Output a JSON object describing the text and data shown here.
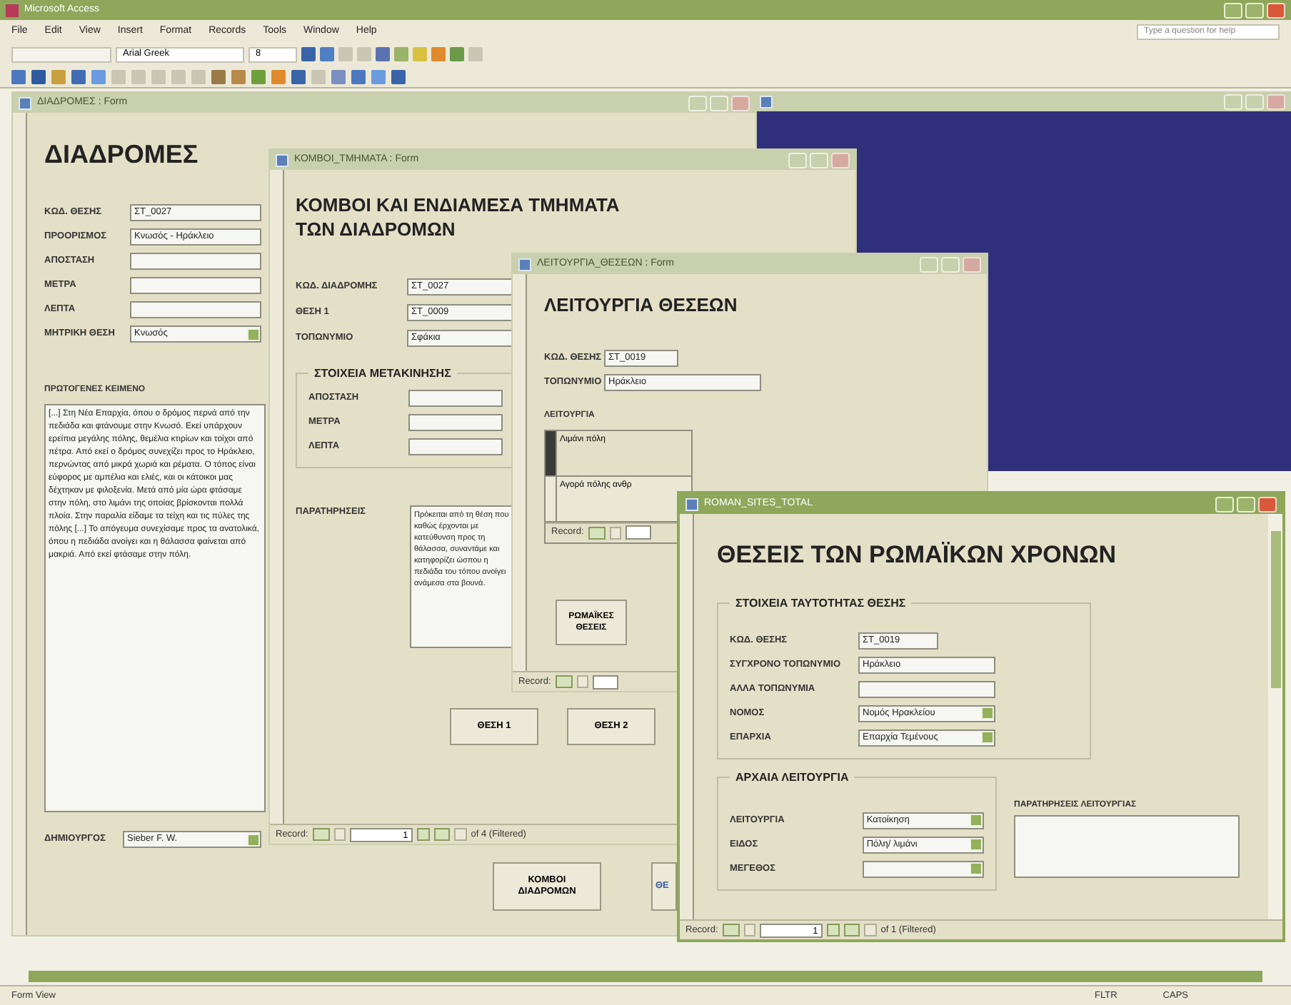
{
  "app": {
    "title": "Microsoft Access",
    "menu": [
      "File",
      "Edit",
      "View",
      "Insert",
      "Format",
      "Records",
      "Tools",
      "Window",
      "Help"
    ],
    "help_box": {
      "placeholder": "Type a question for help"
    },
    "font_box": {
      "value": "Arial Greek"
    },
    "size_box": {
      "value": "8"
    }
  },
  "routes_form": {
    "title": "ΔΙΑΔΡΟΜΕΣ : Form",
    "heading": "ΔΙΑΔΡΟΜΕΣ",
    "fields": [
      {
        "label": "ΚΩΔ. ΘΕΣΗΣ",
        "value": "ΣΤ_0027",
        "kind": "text"
      },
      {
        "label": "ΠΡΟΟΡΙΣΜΟΣ",
        "value": "Κνωσός - Ηράκλειο",
        "kind": "text"
      },
      {
        "label": "ΑΠΟΣΤΑΣΗ",
        "kind": "text"
      },
      {
        "label": "ΜΕΤΡΑ",
        "kind": "text"
      },
      {
        "label": "ΛΕΠΤΑ",
        "kind": "text"
      },
      {
        "label": "ΜΗΤΡΙΚΗ ΘΕΣΗ",
        "value": "Κνωσός",
        "kind": "combo"
      }
    ],
    "memo_label": "ΠΡΩΤΟΓΕΝΕΣ ΚΕΙΜΕΝΟ",
    "memo": "[...] Στη Νέα Επαρχία, όπου ο δρόμος περνά από την πεδιάδα και φτάνουμε στην Κνωσό. Εκεί υπάρχουν ερείπια μεγάλης πόλης, θεμέλια κτιρίων και τοίχοι από πέτρα. Από εκεί ο δρόμος συνεχίζει προς το Ηράκλειο, περνώντας από μικρά χωριά και ρέματα. Ο τόπος είναι εύφορος με αμπέλια και ελιές, και οι κάτοικοι μας δέχτηκαν με φιλοξενία. Μετά από μία ώρα φτάσαμε στην πόλη, στο λιμάνι της οποίας βρίσκονται πολλά πλοία. Στην παραλία είδαμε τα τείχη και τις πύλες της πόλης [...] Το απόγευμα συνεχίσαμε προς τα ανατολικά, όπου η πεδιάδα ανοίγει και η θάλασσα φαίνεται από μακριά. Από εκεί φτάσαμε στην πόλη.",
    "author": {
      "label": "ΔΗΜΙΟΥΡΓΟΣ",
      "value": "Sieber F. W."
    },
    "buttons": [
      "ΚΟΜΒΟΙ ΔΙΑΔΡΟΜΩΝ",
      "ΘΕ"
    ]
  },
  "nodes_form": {
    "title": "ΚΟΜΒΟΙ_ΤΜΗΜΑΤΑ : Form",
    "heading": "ΚΟΜΒΟΙ ΚΑΙ ΕΝΔΙΑΜΕΣΑ ΤΜΗΜΑΤΑ ΤΩΝ ΔΙΑΔΡΟΜΩΝ",
    "fields": [
      {
        "label": "ΚΩΔ. ΔΙΑΔΡΟΜΗΣ",
        "value": "ΣΤ_0027"
      },
      {
        "label": "ΘΕΣΗ 1",
        "value": "ΣΤ_0009"
      },
      {
        "label": "ΤΟΠΩΝΥΜΙΟ",
        "value": "Σφάκια"
      }
    ],
    "group": {
      "title": "ΣΤΟΙΧΕΙΑ ΜΕΤΑΚΙΝΗΣΗΣ",
      "fields": [
        "ΑΠΟΣΤΑΣΗ",
        "ΜΕΤΡΑ",
        "ΛΕΠΤΑ"
      ]
    },
    "notes_label": "ΠΑΡΑΤΗΡΗΣΕΙΣ",
    "notes": "Πρόκειται από τη θέση που καθώς έρχονται με κατεύθυνση προς τη θάλασσα, συναντάμε και κατηφορίζει ώσπου η πεδιάδα του τόπου ανοίγει ανάμεσα στα βουνά.",
    "buttons": [
      "ΘΕΣΗ 1",
      "ΘΕΣΗ 2"
    ],
    "nav": {
      "label": "Record:",
      "current": "1",
      "total": "of 4 (Filtered)"
    }
  },
  "functions_form": {
    "title": "ΛΕΙΤΟΥΡΓΙΑ_ΘΕΣΕΩΝ : Form",
    "heading": "ΛΕΙΤΟΥΡΓΙΑ ΘΕΣΕΩΝ",
    "fields": [
      {
        "label": "ΚΩΔ. ΘΕΣΗΣ",
        "value": "ΣΤ_0019"
      },
      {
        "label": "ΤΟΠΩΝΥΜΙΟ",
        "value": "Ηράκλειο"
      }
    ],
    "subform_label": "ΛΕΙΤΟΥΡΓΙΑ",
    "rows": [
      {
        "value": "Λιμάνι πόλη",
        "selected": true
      },
      {
        "value": "Αγορά πόλης ανθρ",
        "selected": false
      }
    ],
    "sub_nav": {
      "label": "Record:"
    },
    "buttons": [
      "ΡΩΜΑΪΚΕΣ ΘΕΣΕΙΣ"
    ],
    "nav": {
      "label": "Record:"
    }
  },
  "sites_form": {
    "title": "ROMAN_SITES_TOTAL",
    "heading": "ΘΕΣΕΙΣ ΤΩΝ ΡΩΜΑΪΚΩΝ ΧΡΟΝΩΝ",
    "identity": {
      "title": "ΣΤΟΙΧΕΙΑ ΤΑΥΤΟΤΗΤΑΣ ΘΕΣΗΣ",
      "fields": [
        {
          "label": "ΚΩΔ. ΘΕΣΗΣ",
          "value": "ΣΤ_0019",
          "kind": "text"
        },
        {
          "label": "ΣΥΓΧΡΟΝΟ ΤΟΠΩΝΥΜΙΟ",
          "value": "Ηράκλειο",
          "kind": "text"
        },
        {
          "label": "ΑΛΛΑ ΤΟΠΩΝΥΜΙΑ",
          "kind": "text"
        },
        {
          "label": "ΝΟΜΟΣ",
          "value": "Νομός Ηρακλείου",
          "kind": "combo"
        },
        {
          "label": "ΕΠΑΡΧΙΑ",
          "value": "Επαρχία Τεμένους",
          "kind": "combo"
        }
      ]
    },
    "ancient": {
      "title": "ΑΡΧΑΙΑ ΛΕΙΤΟΥΡΓΙΑ",
      "fields": [
        {
          "label": "ΛΕΙΤΟΥΡΓΙΑ",
          "value": "Κατοίκηση"
        },
        {
          "label": "ΕΙΔΟΣ",
          "value": "Πόλη/ λιμάνι"
        },
        {
          "label": "ΜΕΓΕΘΟΣ"
        }
      ],
      "notes_label": "ΠΑΡΑΤΗΡΗΣΕΙΣ ΛΕΙΤΟΥΡΓΙΑΣ"
    },
    "nav": {
      "label": "Record:",
      "current": "1",
      "total": "of 1 (Filtered)"
    }
  },
  "status_bar": {
    "mode": "Form View",
    "indicators": [
      "FLTR",
      "CAPS"
    ]
  }
}
